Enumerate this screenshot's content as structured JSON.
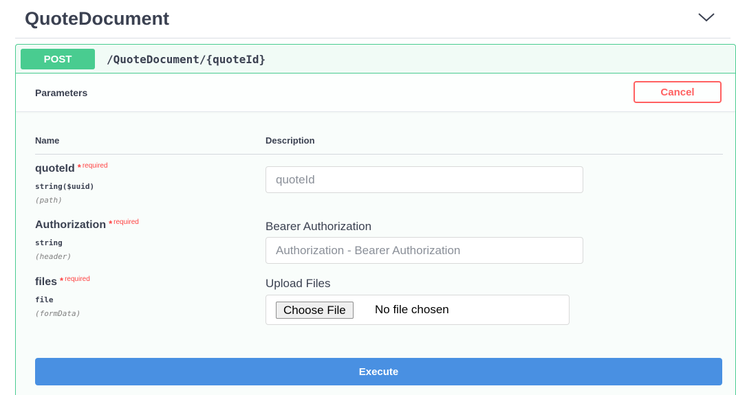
{
  "section": {
    "title": "QuoteDocument",
    "chevron_icon": "chevron-down-icon"
  },
  "operation": {
    "method": "POST",
    "path": "/QuoteDocument/{quoteId}",
    "method_color": "#49cc90"
  },
  "parameters_bar": {
    "title": "Parameters",
    "cancel_label": "Cancel"
  },
  "table": {
    "col_name": "Name",
    "col_description": "Description"
  },
  "params": [
    {
      "name": "quoteId",
      "required_star": "*",
      "required_label": "required",
      "type": "string($uuid)",
      "in": "(path)",
      "description": "",
      "placeholder": "quoteId"
    },
    {
      "name": "Authorization",
      "required_star": "*",
      "required_label": "required",
      "type": "string",
      "in": "(header)",
      "description": "Bearer Authorization",
      "placeholder": "Authorization - Bearer Authorization"
    },
    {
      "name": "files",
      "required_star": "*",
      "required_label": "required",
      "type": "file",
      "in": "(formData)",
      "description": "Upload Files",
      "choose_label": "Choose File",
      "file_status": "No file chosen"
    }
  ],
  "execute_label": "Execute",
  "colors": {
    "execute": "#4990e2",
    "cancel": "#ff6060",
    "required": "#ff4141"
  }
}
